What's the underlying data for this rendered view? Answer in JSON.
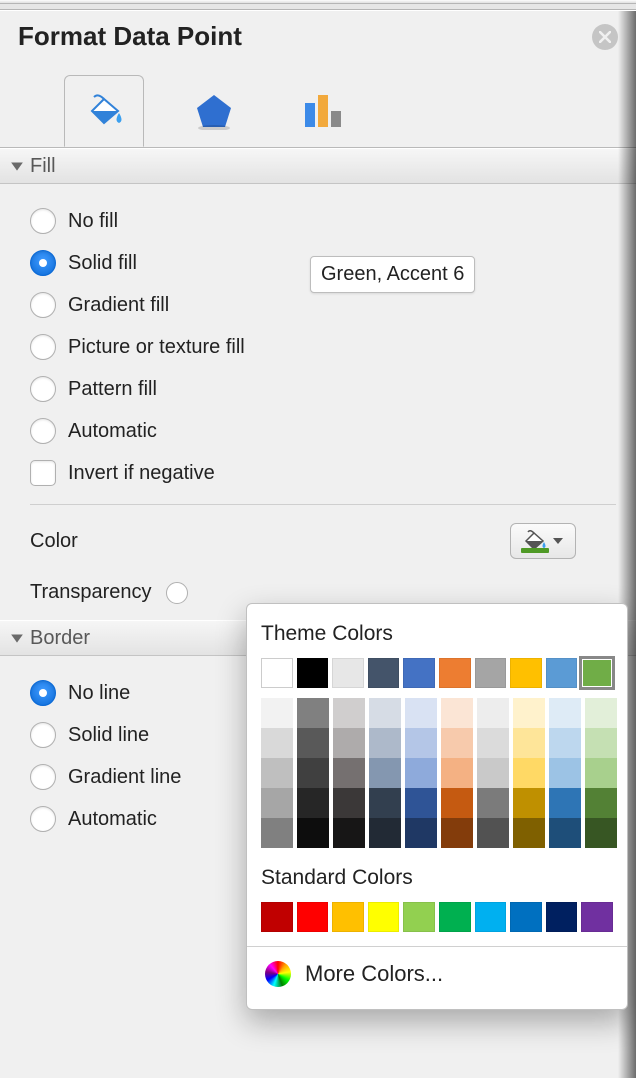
{
  "pane": {
    "title": "Format Data Point"
  },
  "tooltip": "Green, Accent 6",
  "sections": {
    "fill": {
      "header": "Fill",
      "options": {
        "no_fill": "No fill",
        "solid_fill": "Solid fill",
        "gradient_fill": "Gradient fill",
        "picture_fill": "Picture or texture fill",
        "pattern_fill": "Pattern fill",
        "automatic": "Automatic"
      },
      "selected": "solid_fill",
      "invert_label": "Invert if negative",
      "color_label": "Color",
      "current_color": "#4f9a26",
      "transparency_label": "Transparency"
    },
    "border": {
      "header": "Border",
      "options": {
        "no_line": "No line",
        "solid_line": "Solid line",
        "gradient_line": "Gradient line",
        "automatic": "Automatic"
      },
      "selected": "no_line"
    }
  },
  "color_picker": {
    "theme_title": "Theme Colors",
    "theme_row": [
      "#ffffff",
      "#000000",
      "#e7e7e7",
      "#44546a",
      "#4472c4",
      "#ed7d31",
      "#a5a5a5",
      "#ffc000",
      "#5b9bd5",
      "#70ad47"
    ],
    "theme_selected_index": 9,
    "shade_columns": [
      [
        "#f2f2f2",
        "#d9d9d9",
        "#bfbfbf",
        "#a6a6a6",
        "#808080"
      ],
      [
        "#808080",
        "#595959",
        "#404040",
        "#262626",
        "#0d0d0d"
      ],
      [
        "#d0cece",
        "#aeabab",
        "#757070",
        "#3b3838",
        "#171616"
      ],
      [
        "#d6dce5",
        "#adb9ca",
        "#8497b0",
        "#323f4f",
        "#222a35"
      ],
      [
        "#d9e2f3",
        "#b4c6e7",
        "#8eaadb",
        "#2f5496",
        "#1f3864"
      ],
      [
        "#fbe5d5",
        "#f7caac",
        "#f4b183",
        "#c55a11",
        "#833c0b"
      ],
      [
        "#ededed",
        "#dbdbdb",
        "#c9c9c9",
        "#7b7b7b",
        "#525252"
      ],
      [
        "#fff2cc",
        "#fee599",
        "#ffd965",
        "#bf9000",
        "#7f6000"
      ],
      [
        "#deebf6",
        "#bdd7ee",
        "#9cc3e5",
        "#2e75b5",
        "#1e4e79"
      ],
      [
        "#e2efd9",
        "#c5e0b3",
        "#a8d08d",
        "#538135",
        "#375623"
      ]
    ],
    "standard_title": "Standard Colors",
    "standard_row": [
      "#c00000",
      "#ff0000",
      "#ffc000",
      "#ffff00",
      "#92d050",
      "#00b050",
      "#00b0f0",
      "#0070c0",
      "#002060",
      "#7030a0"
    ],
    "more_label": "More Colors..."
  }
}
